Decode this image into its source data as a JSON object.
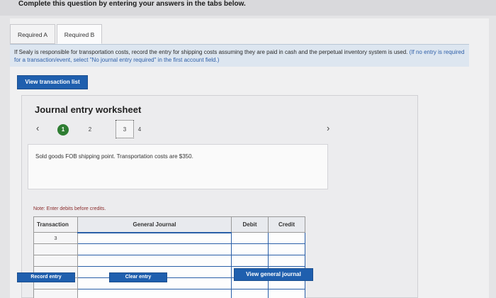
{
  "header": {
    "instruction": "Complete this question by entering your answers in the tabs below."
  },
  "tabs": [
    {
      "label": "Required A",
      "active": false
    },
    {
      "label": "Required B",
      "active": true
    }
  ],
  "question": {
    "text": "If Sealy is responsible for transportation costs, record the entry for shipping costs assuming they are paid in cash and the perpetual inventory system is used.",
    "note": "(If no entry is required for a transaction/event, select \"No journal entry required\" in the first account field.)"
  },
  "buttons": {
    "view_transaction_list": "View transaction list",
    "record_entry": "Record entry",
    "clear_entry": "Clear entry",
    "view_general_journal": "View general journal"
  },
  "worksheet": {
    "title": "Journal entry worksheet",
    "prev_icon": "chevron-left-icon",
    "next_icon": "chevron-right-icon",
    "steps": [
      {
        "label": "1",
        "status": "done"
      },
      {
        "label": "2",
        "status": "default"
      },
      {
        "label": "3",
        "status": "current"
      },
      {
        "label": "4",
        "status": "default"
      }
    ],
    "description": "Sold goods FOB shipping point. Transportation costs are $350.",
    "note": "Note: Enter debits before credits."
  },
  "journal": {
    "columns": [
      "Transaction",
      "General Journal",
      "Debit",
      "Credit"
    ],
    "transaction_number": "3",
    "rows": [
      {
        "account": "",
        "debit": "",
        "credit": ""
      },
      {
        "account": "",
        "debit": "",
        "credit": ""
      },
      {
        "account": "",
        "debit": "",
        "credit": ""
      },
      {
        "account": "",
        "debit": "",
        "credit": ""
      },
      {
        "account": "",
        "debit": "",
        "credit": ""
      },
      {
        "account": "",
        "debit": "",
        "credit": ""
      }
    ]
  },
  "colors": {
    "primary_button": "#1f5fae",
    "instruction_bg": "#dde6f0",
    "step_done": "#2e7d32",
    "note_text": "#8a2c2c"
  }
}
